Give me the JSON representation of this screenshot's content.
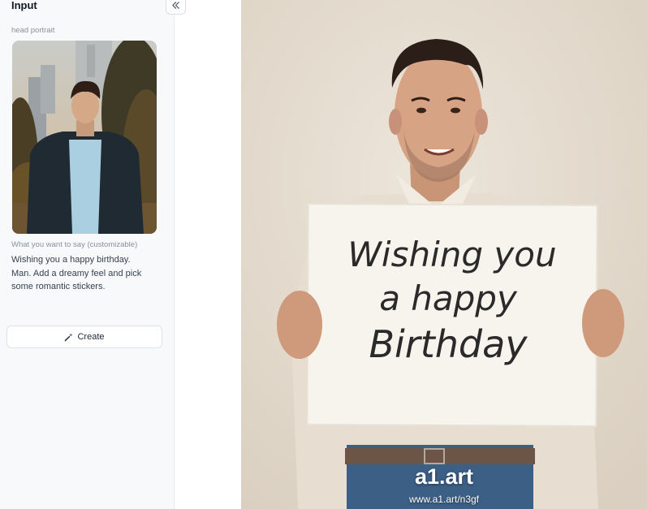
{
  "panel": {
    "title": "Input",
    "collapse_icon": "double-chevron-left-icon"
  },
  "portrait_field": {
    "label": "head portrait"
  },
  "message_field": {
    "label": "What you want to say (customizable)",
    "value": "Wishing you a happy birthday. Man. Add a dreamy feel and pick some romantic stickers."
  },
  "create_button": {
    "label": "Create",
    "icon": "magic-wand-icon"
  },
  "result": {
    "sign_lines": [
      "Wishing you",
      "a happy",
      "Birthday"
    ],
    "watermark_logo": "a1.art",
    "watermark_url": "www.a1.art/n3gf"
  },
  "colors": {
    "sidebar_bg": "#f7f9fb",
    "photo_wall": "#e4dacd"
  }
}
